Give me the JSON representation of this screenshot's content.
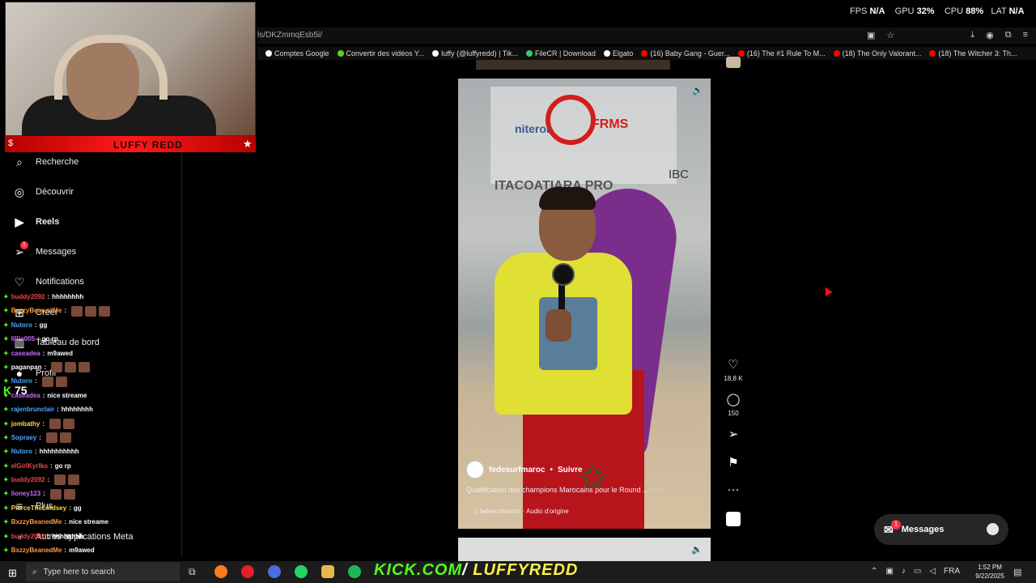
{
  "overlay": {
    "fps_label": "FPS",
    "fps_value": "N/A",
    "gpu_label": "GPU",
    "gpu_value": "32%",
    "cpu_label": "CPU",
    "cpu_value": "88%",
    "lat_label": "LAT",
    "lat_value": "N/A"
  },
  "browser": {
    "url": "ls/DKZmmqEsb5i/",
    "bookmarks": [
      {
        "label": "Comptes Google",
        "color": "#fff"
      },
      {
        "label": "Convertir des vidéos Y...",
        "color": "#5cd21b"
      },
      {
        "label": "luffy (@luffyredd) | Tik...",
        "color": "#fff"
      },
      {
        "label": "FileCR | Download",
        "color": "#3ec46d"
      },
      {
        "label": "Elgato",
        "color": "#fff"
      },
      {
        "label": "(16) Baby Gang - Guer...",
        "color": "#ff0000"
      },
      {
        "label": "(16) The #1 Rule To M...",
        "color": "#ff0000"
      },
      {
        "label": "(18) The Only Valorant...",
        "color": "#ff0000"
      },
      {
        "label": "(18) The Witcher 3: Th...",
        "color": "#ff0000"
      }
    ]
  },
  "stream": {
    "banner": "LUFFY REDD",
    "viewers": "75"
  },
  "sidebar": {
    "items": [
      {
        "label": "Recherche"
      },
      {
        "label": "Découvrir"
      },
      {
        "label": "Reels"
      },
      {
        "label": "Messages",
        "badge": "1"
      },
      {
        "label": "Notifications"
      },
      {
        "label": "Créer"
      },
      {
        "label": "Tableau de bord"
      },
      {
        "label": "Profil"
      },
      {
        "label": "Plus"
      },
      {
        "label": "Autres applications Meta"
      }
    ]
  },
  "chat": [
    {
      "user": "buddy2092",
      "color": "#e84a4a",
      "msg": "hhhhhhhh",
      "emotes": 0
    },
    {
      "user": "BxzzyBeanedMe",
      "color": "#ff9a3c",
      "msg": "",
      "emotes": 3
    },
    {
      "user": "Nutoro",
      "color": "#4da6ff",
      "msg": "gg",
      "emotes": 0
    },
    {
      "user": "lillin005",
      "color": "#c86dff",
      "msg": "go rp",
      "emotes": 0
    },
    {
      "user": "caseadea",
      "color": "#c86dff",
      "msg": "m9awed",
      "emotes": 0
    },
    {
      "user": "paganpan",
      "color": "#ffffff",
      "msg": "",
      "emotes": 3
    },
    {
      "user": "Nutoro",
      "color": "#4da6ff",
      "msg": "",
      "emotes": 2
    },
    {
      "user": "caseadea",
      "color": "#c86dff",
      "msg": "nice streame",
      "emotes": 0
    },
    {
      "user": "rajenbrunclair",
      "color": "#4da6ff",
      "msg": "hhhhhhhh",
      "emotes": 0
    },
    {
      "user": "jombathy",
      "color": "#ffd84a",
      "msg": "",
      "emotes": 2
    },
    {
      "user": "Sopraey",
      "color": "#4da6ff",
      "msg": "",
      "emotes": 2
    },
    {
      "user": "Nutoro",
      "color": "#4da6ff",
      "msg": "hhhhhhhhhh",
      "emotes": 0
    },
    {
      "user": "elGirlKyrlko",
      "color": "#e84a4a",
      "msg": "go rp",
      "emotes": 0
    },
    {
      "user": "buddy2092",
      "color": "#e84a4a",
      "msg": "",
      "emotes": 2
    },
    {
      "user": "lioney123",
      "color": "#c86dff",
      "msg": "",
      "emotes": 2
    },
    {
      "user": "PierceTheLindsey",
      "color": "#ffd84a",
      "msg": "gg",
      "emotes": 0
    },
    {
      "user": "BxzzyBeanedMe",
      "color": "#ff9a3c",
      "msg": "nice streame",
      "emotes": 0
    },
    {
      "user": "buddy2092",
      "color": "#e84a4a",
      "msg": "hhhhhhhh",
      "emotes": 0
    },
    {
      "user": "BxzzyBeanedMe",
      "color": "#ff9a3c",
      "msg": "m9awed",
      "emotes": 0
    }
  ],
  "reel": {
    "sign_top": "FRMS",
    "sign_left": "niteroi",
    "sign_right": "IBC",
    "sign_mid": "ITACOATIARA PRO",
    "author": "fedesurfmaroc",
    "follow": "Suivre",
    "caption": "Qualification des champions Marocains pour le Round ...",
    "more": "plus",
    "audio": "fedesurfmaroc · Audio d'origine",
    "likes": "18,8 K",
    "comments": "150"
  },
  "messages_pill": {
    "label": "Messages",
    "badge": "1"
  },
  "taskbar": {
    "search_placeholder": "Type here to search",
    "kick_prefix": "KICK.COM",
    "kick_slash": "/",
    "kick_name": "LUFFYREDD",
    "lang": "FRA",
    "time": "1:52 PM",
    "date": "9/22/2025"
  },
  "colors": {
    "accent_red": "#ff3040",
    "kick_green": "#53fc18",
    "kick_yellow": "#fff24a"
  }
}
